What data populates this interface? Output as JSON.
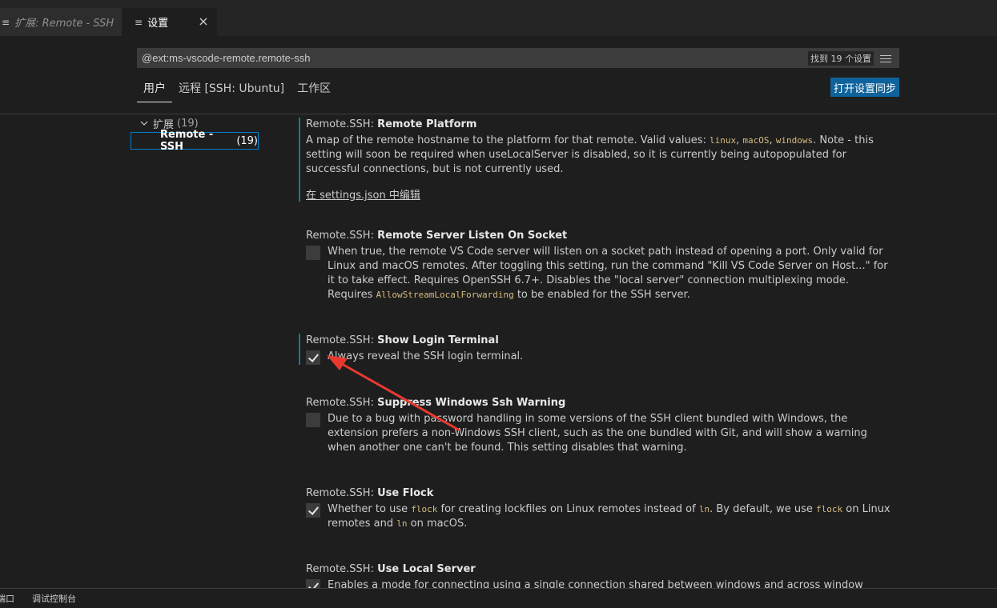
{
  "tabs": [
    {
      "label": "扩展: Remote - SSH",
      "icon": "preview-icon"
    },
    {
      "label": "设置",
      "icon": "settings-list-icon",
      "close": "×"
    }
  ],
  "search": {
    "value": "@ext:ms-vscode-remote.remote-ssh",
    "result_count": "找到 19 个设置"
  },
  "scope_tabs": [
    "用户",
    "远程 [SSH: Ubuntu]",
    "工作区"
  ],
  "sync_button": "打开设置同步",
  "toc": {
    "group_label": "扩展",
    "group_count": "(19)",
    "item_label": "Remote - SSH",
    "item_count": "(19)"
  },
  "settings": {
    "remote_platform": {
      "category": "Remote.SSH: ",
      "name": "Remote Platform",
      "desc_1": "A map of the remote hostname to the platform for that remote. Valid values: ",
      "code_1": "linux",
      "sep_1": ", ",
      "code_2": "macOS",
      "sep_2": ", ",
      "code_3": "windows",
      "desc_2": ". Note - this setting will soon be required when useLocalServer is disabled, so it is currently being autopopulated for successful connections, but is not currently used.",
      "edit_link": "在 settings.json 中编辑"
    },
    "listen_on_socket": {
      "category": "Remote.SSH: ",
      "name": "Remote Server Listen On Socket",
      "checked": false,
      "desc_1": "When true, the remote VS Code server will listen on a socket path instead of opening a port. Only valid for Linux and macOS remotes. After toggling this setting, run the command \"Kill VS Code Server on Host...\" for it to take effect. Requires OpenSSH 6.7+. Disables the \"local server\" connection multiplexing mode. Requires ",
      "code_1": "AllowStreamLocalForwarding",
      "desc_2": " to be enabled for the SSH server."
    },
    "show_login_terminal": {
      "category": "Remote.SSH: ",
      "name": "Show Login Terminal",
      "checked": true,
      "desc": "Always reveal the SSH login terminal."
    },
    "suppress_warning": {
      "category": "Remote.SSH: ",
      "name": "Suppress Windows Ssh Warning",
      "checked": false,
      "desc": "Due to a bug with password handling in some versions of the SSH client bundled with Windows, the extension prefers a non-Windows SSH client, such as the one bundled with Git, and will show a warning when another one can't be found. This setting disables that warning."
    },
    "use_flock": {
      "category": "Remote.SSH: ",
      "name": "Use Flock",
      "checked": true,
      "desc_1": "Whether to use ",
      "code_1": "flock",
      "desc_2": " for creating lockfiles on Linux remotes instead of ",
      "code_2": "ln",
      "desc_3": ". By default, we use ",
      "code_3": "flock",
      "desc_4": " on Linux remotes and ",
      "code_4": "ln",
      "desc_5": " on macOS."
    },
    "use_local_server": {
      "category": "Remote.SSH: ",
      "name": "Use Local Server",
      "checked": true,
      "desc": "Enables a mode for connecting using a single connection shared between windows and across window reloads. This"
    }
  },
  "statusbar": {
    "ports": "端口",
    "debug_console": "调试控制台"
  },
  "annotation_color": "#e8392f"
}
